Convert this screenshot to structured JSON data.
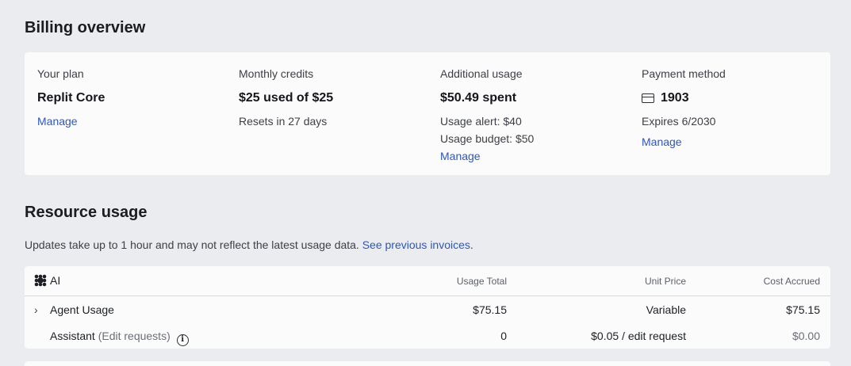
{
  "billing": {
    "title": "Billing overview",
    "plan": {
      "label": "Your plan",
      "value": "Replit Core",
      "link": "Manage"
    },
    "credits": {
      "label": "Monthly credits",
      "value": "$25 used of $25",
      "sub": "Resets in 27 days"
    },
    "additional": {
      "label": "Additional usage",
      "value": "$50.49 spent",
      "alert": "Usage alert: $40",
      "budget": "Usage budget: $50",
      "link": "Manage"
    },
    "payment": {
      "label": "Payment method",
      "icon": "credit-card-icon",
      "value": "1903",
      "expires": "Expires 6/2030",
      "link": "Manage"
    }
  },
  "resources": {
    "title": "Resource usage",
    "note": "Updates take up to 1 hour and may not reflect the latest usage data.",
    "note_link": "See previous invoices",
    "note_end": ".",
    "table": {
      "section": "AI",
      "section_icon": "ai-flower-icon",
      "columns": [
        "Usage Total",
        "Unit Price",
        "Cost Accrued"
      ],
      "rows": [
        {
          "name": "Agent Usage",
          "detail": "",
          "usage": "$75.15",
          "price": "Variable",
          "cost": "$75.15",
          "expandable": true
        },
        {
          "name": "Assistant",
          "detail": "(Edit requests)",
          "usage": "0",
          "price": "$0.05 / edit request",
          "cost": "$0.00",
          "expandable": false
        }
      ]
    }
  }
}
